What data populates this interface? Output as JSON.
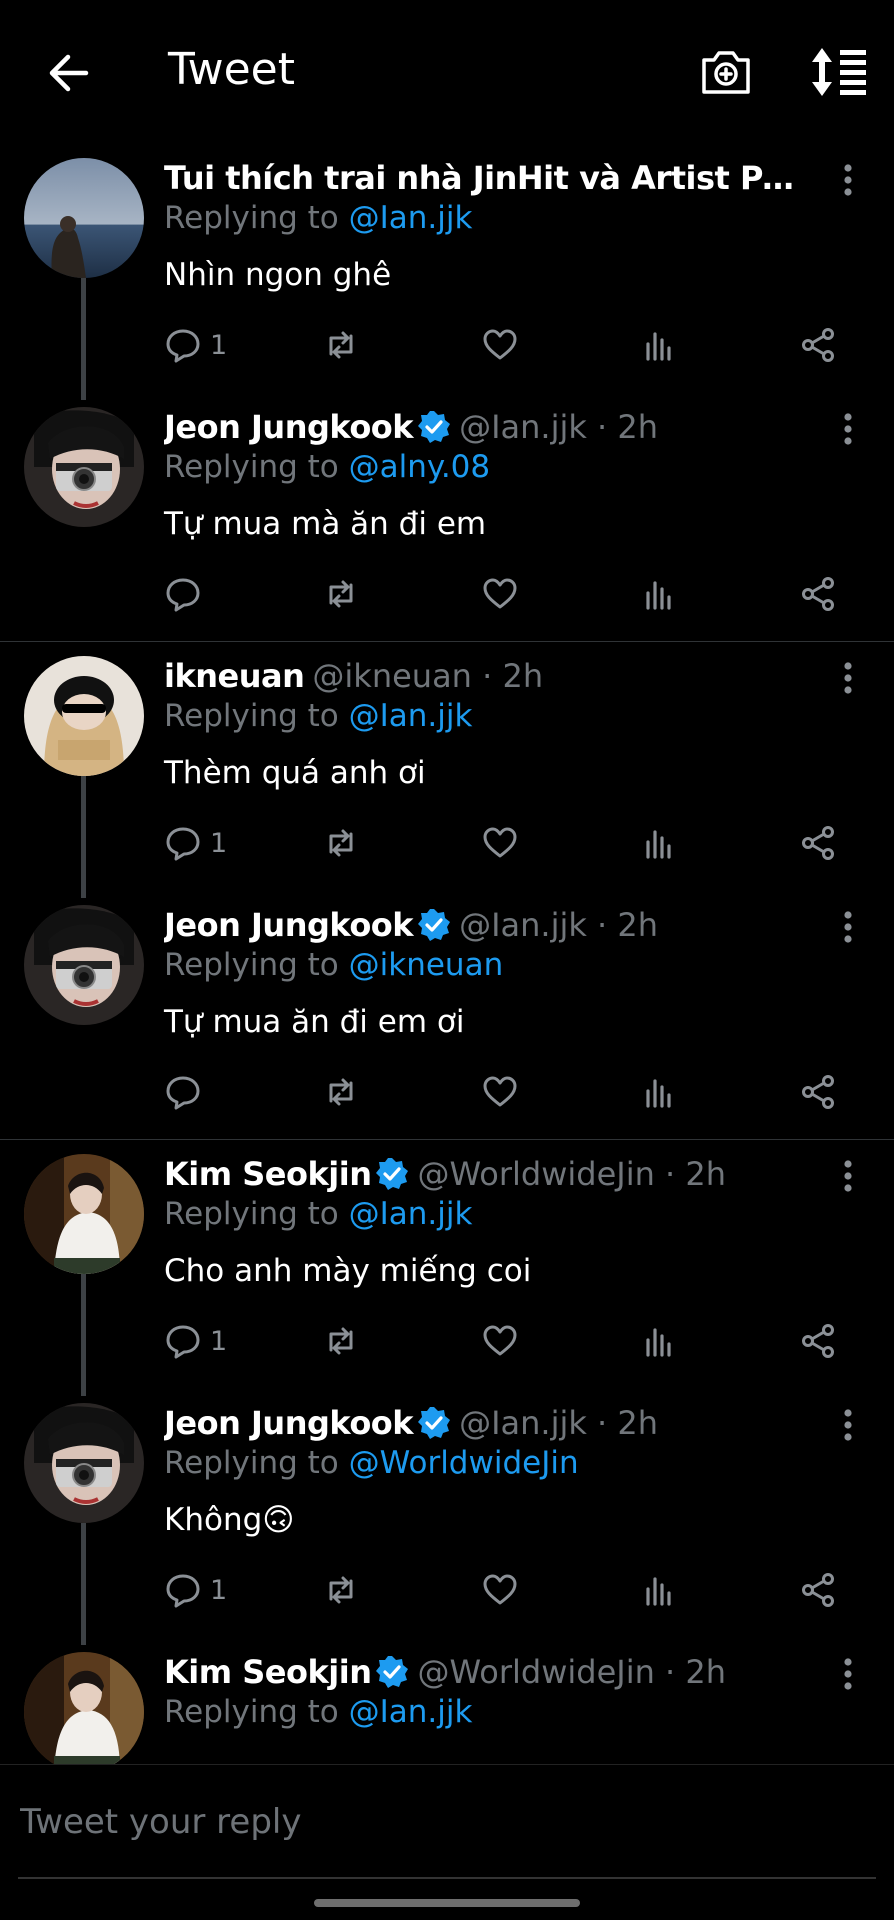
{
  "header": {
    "title": "Tweet",
    "back_icon": "arrow-left-icon",
    "camera_icon": "camera-add-icon",
    "sort_icon": "sort-icon"
  },
  "colors": {
    "background": "#000000",
    "accent": "#1d9bf0",
    "muted": "#71767b"
  },
  "tweets": [
    {
      "name": "Tui thích trai nhà JinHit và Artist Park Jimin ...",
      "handle": "",
      "time": "",
      "verified": false,
      "replying_prefix": "Replying to",
      "replying_to": "@Ian.jjk",
      "text": "Nhìn ngon ghê",
      "reply_count": "1",
      "avatar": "sea-avatar"
    },
    {
      "name": "Jeon Jungkook",
      "handle": "@Ian.jjk · 2h",
      "verified": true,
      "replying_prefix": "Replying to",
      "replying_to": "@alny.08",
      "text": "Tự mua mà ăn đi em",
      "reply_count": "",
      "avatar": "jungkook-avatar"
    },
    {
      "name": "ikneuan",
      "handle": "@ikneuan · 2h",
      "verified": false,
      "replying_prefix": "Replying to",
      "replying_to": "@Ian.jjk",
      "text": "Thèm quá anh ơi",
      "reply_count": "1",
      "avatar": "ikneuan-avatar"
    },
    {
      "name": "Jeon Jungkook",
      "handle": "@Ian.jjk · 2h",
      "verified": true,
      "replying_prefix": "Replying to",
      "replying_to": "@ikneuan",
      "text": "Tự mua ăn đi em ơi",
      "reply_count": "",
      "avatar": "jungkook-avatar"
    },
    {
      "name": "Kim Seokjin",
      "handle": "@WorldwideJin · 2h",
      "verified": true,
      "replying_prefix": "Replying to",
      "replying_to": "@Ian.jjk",
      "text": "Cho anh mày miếng coi",
      "reply_count": "1",
      "avatar": "seokjin-avatar"
    },
    {
      "name": "Jeon Jungkook",
      "handle": "@Ian.jjk · 2h",
      "verified": true,
      "replying_prefix": "Replying to",
      "replying_to": "@WorldwideJin",
      "text": "Không🙃",
      "reply_count": "1",
      "avatar": "jungkook-avatar"
    },
    {
      "name": "Kim Seokjin",
      "handle": "@WorldwideJin · 2h",
      "verified": true,
      "replying_prefix": "Replying to",
      "replying_to": "@Ian.jjk",
      "text": "",
      "reply_count": "",
      "avatar": "seokjin-avatar"
    }
  ],
  "reply": {
    "placeholder": "Tweet your reply"
  }
}
